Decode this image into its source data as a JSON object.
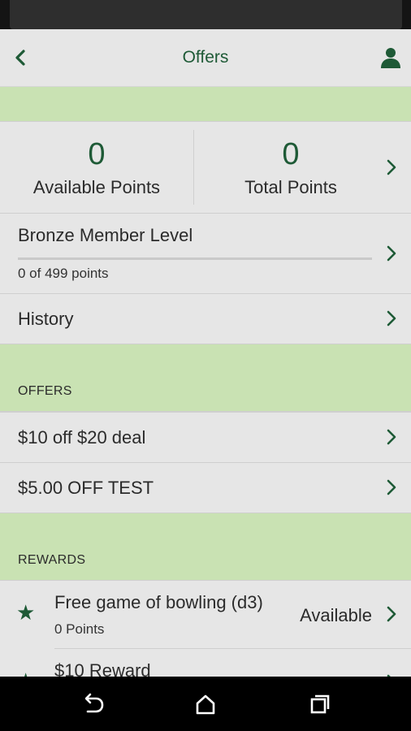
{
  "header": {
    "title": "Offers"
  },
  "points": {
    "available_value": "0",
    "available_label": "Available Points",
    "total_value": "0",
    "total_label": "Total Points"
  },
  "member_level": {
    "label": "Bronze Member Level",
    "progress_text": "0 of 499 points",
    "progress": 0
  },
  "history": {
    "label": "History"
  },
  "offers": {
    "section_label": "OFFERS",
    "items": [
      {
        "label": "$10 off $20 deal"
      },
      {
        "label": "$5.00 OFF TEST"
      }
    ]
  },
  "rewards": {
    "section_label": "REWARDS",
    "items": [
      {
        "title": "Free game of bowling (d3)",
        "points": "0 Points",
        "status": "Available"
      },
      {
        "title": "$10 Reward",
        "points": "",
        "status": ""
      }
    ]
  },
  "colors": {
    "accent": "#1e5a36",
    "band": "#c9e2b3",
    "background": "#e6e6e6"
  },
  "icons": {
    "back": "chevron-left-icon",
    "profile": "person-icon",
    "star": "star-icon",
    "nav_back": "back-arrow-icon",
    "nav_home": "home-icon",
    "nav_recents": "recents-icon"
  }
}
